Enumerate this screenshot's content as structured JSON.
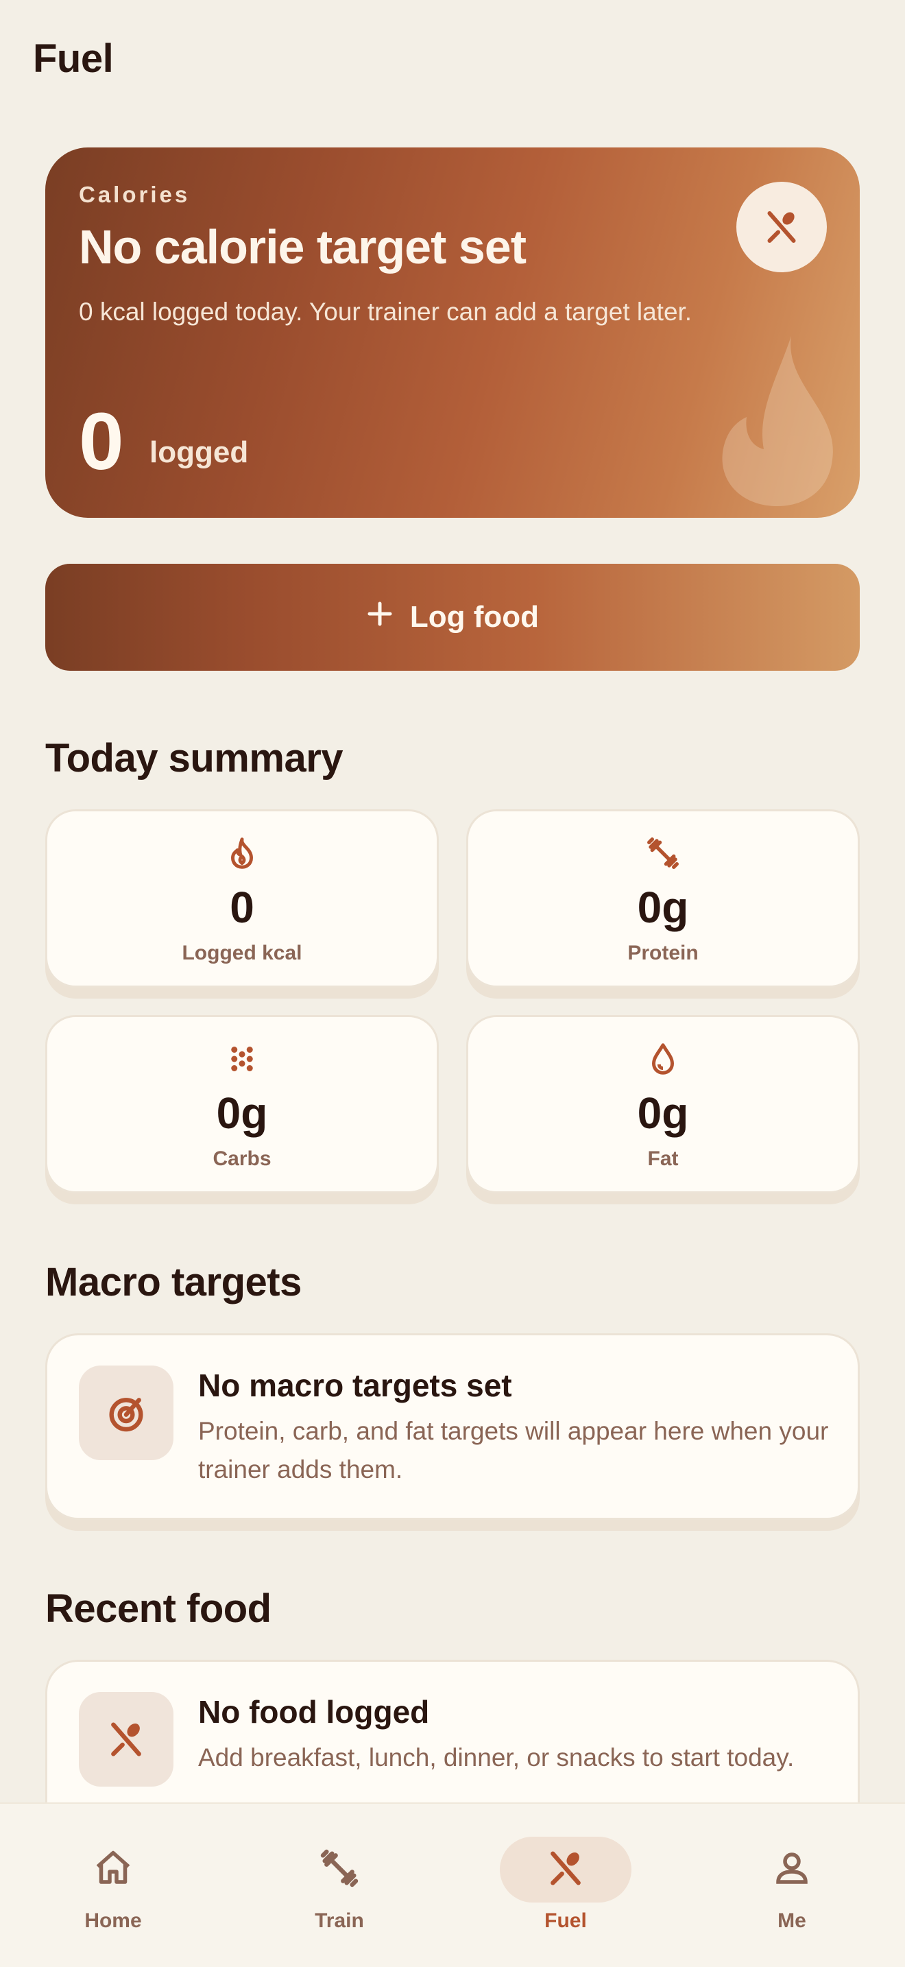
{
  "header": {
    "title": "Fuel"
  },
  "hero": {
    "eyebrow": "Calories",
    "title": "No calorie target set",
    "description": "0 kcal logged today. Your trainer can add a target later.",
    "value": "0",
    "value_label": "logged",
    "badge_icon": "fork-spoon-icon",
    "decor_icon": "flame-icon"
  },
  "actions": {
    "log_food_label": "Log food",
    "log_food_icon": "plus-icon"
  },
  "today_summary": {
    "title": "Today summary",
    "stats": [
      {
        "value": "0",
        "label": "Logged kcal",
        "icon": "flame-icon"
      },
      {
        "value": "0g",
        "label": "Protein",
        "icon": "dumbbell-icon"
      },
      {
        "value": "0g",
        "label": "Carbs",
        "icon": "grain-icon"
      },
      {
        "value": "0g",
        "label": "Fat",
        "icon": "droplet-icon"
      }
    ]
  },
  "macro_targets": {
    "title": "Macro targets",
    "empty_title": "No macro targets set",
    "empty_desc": "Protein, carb, and fat targets will appear here when your trainer adds them.",
    "icon": "target-icon"
  },
  "recent_food": {
    "title": "Recent food",
    "empty_title": "No food logged",
    "empty_desc": "Add breakfast, lunch, dinner, or snacks to start today.",
    "icon": "fork-spoon-icon"
  },
  "nav": {
    "items": [
      {
        "label": "Home",
        "icon": "home-icon",
        "active": false
      },
      {
        "label": "Train",
        "icon": "dumbbell-icon",
        "active": false
      },
      {
        "label": "Fuel",
        "icon": "fork-spoon-icon",
        "active": true
      },
      {
        "label": "Me",
        "icon": "person-icon",
        "active": false
      }
    ]
  },
  "colors": {
    "accent": "#b4532e",
    "background": "#f3efe6",
    "text": "#2a1610",
    "muted": "#8a6555"
  }
}
